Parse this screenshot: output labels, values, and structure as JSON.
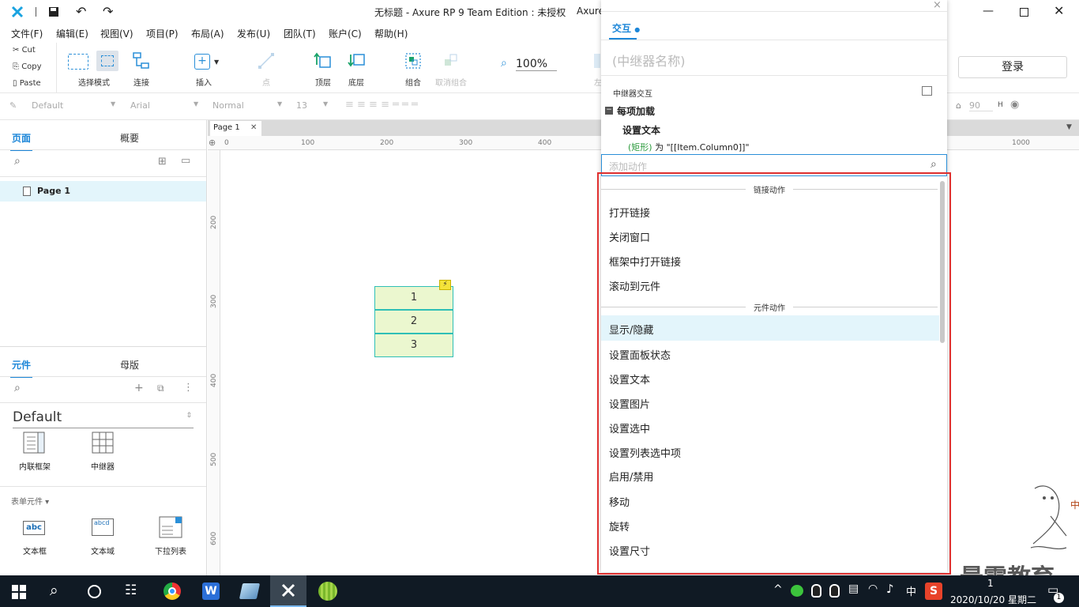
{
  "window": {
    "title": "无标题 - Axure RP 9 Team Edition : 未授权",
    "title_tail": "Axure"
  },
  "menu": [
    "文件(F)",
    "编辑(E)",
    "视图(V)",
    "项目(P)",
    "布局(A)",
    "发布(U)",
    "团队(T)",
    "账户(C)",
    "帮助(H)"
  ],
  "clipboard": {
    "cut": "Cut",
    "copy": "Copy",
    "paste": "Paste"
  },
  "toolbar": {
    "select_mode": "选择模式",
    "connect": "连接",
    "insert": "插入",
    "point": "点",
    "top": "顶层",
    "bottom": "底层",
    "group": "组合",
    "ungroup": "取消组合",
    "zoom": "100%",
    "left_partial": "左",
    "login": "登录"
  },
  "stylebar": {
    "style": "Default",
    "font": "Arial",
    "weight": "Normal",
    "size": "13",
    "h_value": "90",
    "h_label": "H"
  },
  "pages_panel": {
    "tab_pages": "页面",
    "tab_outline": "概要",
    "page_item": "Page 1"
  },
  "widgets_panel": {
    "tab_widgets": "元件",
    "tab_masters": "母版",
    "library": "Default",
    "items": [
      "内联框架",
      "中继器"
    ],
    "form_section": "表单元件",
    "form_items": [
      "文本框",
      "文本域",
      "下拉列表"
    ]
  },
  "canvas": {
    "tab": "Page 1",
    "ruler_h": [
      "0",
      "100",
      "200",
      "300",
      "400",
      "1000"
    ],
    "ruler_v": [
      "200",
      "300",
      "400",
      "500",
      "600"
    ],
    "repeater_rows": [
      "1",
      "2",
      "3"
    ]
  },
  "interactions": {
    "tab": "交互",
    "name_placeholder": "(中继器名称)",
    "section": "中继器交互",
    "event": "每项加载",
    "action": "设置文本",
    "detail_target": "(矩形)",
    "detail_text": " 为 \"[[Item.Column0]]\"",
    "search_placeholder": "添加动作",
    "group_link": "链接动作",
    "link_actions": [
      "打开链接",
      "关闭窗口",
      "框架中打开链接",
      "滚动到元件"
    ],
    "group_widget": "元件动作",
    "widget_actions": [
      "显示/隐藏",
      "设置面板状态",
      "设置文本",
      "设置图片",
      "设置选中",
      "设置列表选中项",
      "启用/禁用",
      "移动",
      "旋转",
      "设置尺寸"
    ]
  },
  "taskbar": {
    "ime": "中",
    "datetime": "2020/10/20 星期二",
    "clock_partial": "1",
    "notif_count": "1"
  },
  "watermark": "最需教育",
  "colors": {
    "accent": "#1c86d8",
    "highlight": "#e3f5fb",
    "red_box": "#e0302f",
    "repeater_fill": "#ebf7cf"
  }
}
